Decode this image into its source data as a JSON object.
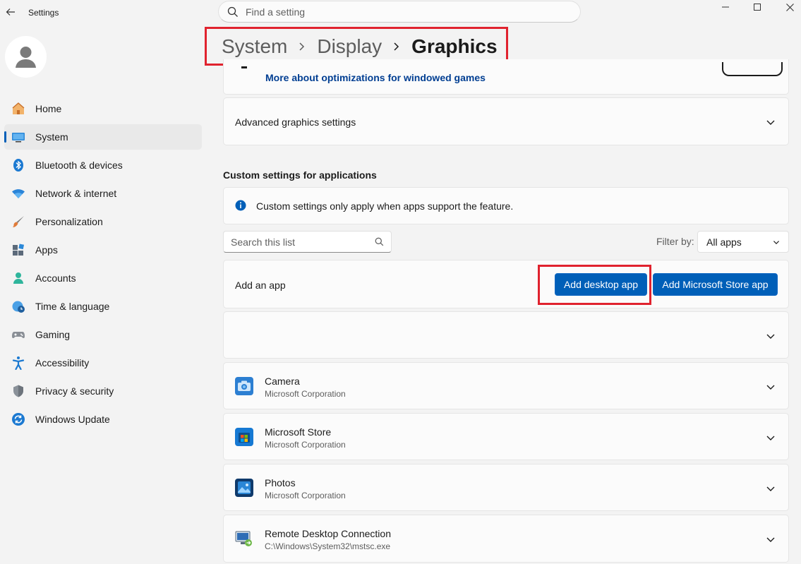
{
  "window": {
    "title": "Settings",
    "search_placeholder": "Find a setting"
  },
  "sidebar": {
    "items": [
      {
        "label": "Home",
        "icon": "home-icon"
      },
      {
        "label": "System",
        "icon": "system-icon",
        "selected": true
      },
      {
        "label": "Bluetooth & devices",
        "icon": "bluetooth-icon"
      },
      {
        "label": "Network & internet",
        "icon": "wifi-icon"
      },
      {
        "label": "Personalization",
        "icon": "brush-icon"
      },
      {
        "label": "Apps",
        "icon": "apps-icon"
      },
      {
        "label": "Accounts",
        "icon": "accounts-icon"
      },
      {
        "label": "Time & language",
        "icon": "globe-clock-icon"
      },
      {
        "label": "Gaming",
        "icon": "gamepad-icon"
      },
      {
        "label": "Accessibility",
        "icon": "accessibility-icon"
      },
      {
        "label": "Privacy & security",
        "icon": "shield-icon"
      },
      {
        "label": "Windows Update",
        "icon": "update-icon"
      }
    ]
  },
  "breadcrumb": {
    "items": [
      "System",
      "Display"
    ],
    "current": "Graphics"
  },
  "main": {
    "windowed_link": "More about optimizations for windowed games",
    "advanced_label": "Advanced graphics settings",
    "custom_section_title": "Custom settings for applications",
    "info_text": "Custom settings only apply when apps support the feature.",
    "list_search_placeholder": "Search this list",
    "filter_label": "Filter by:",
    "filter_value": "All apps",
    "add_app_label": "Add an app",
    "add_desktop_button": "Add desktop app",
    "add_store_button": "Add Microsoft Store app",
    "apps": [
      {
        "name": "Camera",
        "publisher": "Microsoft Corporation",
        "icon": "camera-icon"
      },
      {
        "name": "Microsoft Store",
        "publisher": "Microsoft Corporation",
        "icon": "store-icon"
      },
      {
        "name": "Photos",
        "publisher": "Microsoft Corporation",
        "icon": "photos-icon"
      },
      {
        "name": "Remote Desktop Connection",
        "publisher": "C:\\Windows\\System32\\mstsc.exe",
        "icon": "remote-desktop-icon"
      }
    ]
  },
  "colors": {
    "accent": "#005fb8",
    "highlight_box": "#e0222e",
    "link": "#003e92"
  }
}
